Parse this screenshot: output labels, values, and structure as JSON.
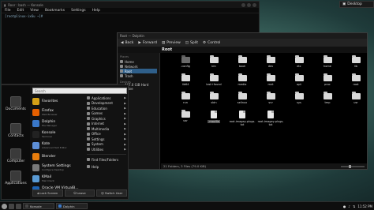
{
  "desktop": {
    "label": "Desktop"
  },
  "terminal": {
    "title": "Roor : bash — Konsole",
    "menu": [
      "File",
      "Edit",
      "View",
      "Bookmarks",
      "Settings",
      "Help"
    ],
    "prompt": "[root@linux-ix6u ~]#"
  },
  "file_manager": {
    "title": "Root — Dolphin",
    "toolbar": [
      "Back",
      "Forward",
      "Preview",
      "Split",
      "Control"
    ],
    "path": "Root",
    "places_heading": "Places",
    "devices_heading": "Devices",
    "places": [
      "Home",
      "Network",
      "Root",
      "Trash"
    ],
    "selected_place": "Root",
    "devices": [
      "447.0 GiB Hard Drive"
    ],
    "items": [
      {
        "name": ".config",
        "kind": "folder-dark"
      },
      {
        "name": "bin",
        "kind": "folder"
      },
      {
        "name": "boot",
        "kind": "folder"
      },
      {
        "name": "dev",
        "kind": "folder"
      },
      {
        "name": "etc",
        "kind": "folder"
      },
      {
        "name": "home",
        "kind": "folder"
      },
      {
        "name": "lib",
        "kind": "folder"
      },
      {
        "name": "lib64",
        "kind": "folder"
      },
      {
        "name": "lost+found",
        "kind": "folder"
      },
      {
        "name": "media",
        "kind": "folder"
      },
      {
        "name": "mnt",
        "kind": "folder"
      },
      {
        "name": "opt",
        "kind": "folder"
      },
      {
        "name": "proc",
        "kind": "folder"
      },
      {
        "name": "root",
        "kind": "folder"
      },
      {
        "name": "run",
        "kind": "folder"
      },
      {
        "name": "sbin",
        "kind": "folder"
      },
      {
        "name": "selinux",
        "kind": "folder"
      },
      {
        "name": "srv",
        "kind": "folder"
      },
      {
        "name": "sys",
        "kind": "folder"
      },
      {
        "name": "tmp",
        "kind": "folder"
      },
      {
        "name": "usr",
        "kind": "folder"
      },
      {
        "name": "var",
        "kind": "folder"
      },
      {
        "name": ".mozilla",
        "kind": "file",
        "highlight": true
      },
      {
        "name": "root.imagey-plugs.\ntxt",
        "kind": "file"
      },
      {
        "name": "root.imagey-plugs.\ntxt",
        "kind": "file"
      }
    ],
    "status": "21 Folders, 3 Files (79.0 KiB)"
  },
  "start_menu": {
    "search_placeholder": "Search",
    "sidebar": [
      "Documents",
      "Contacts",
      "Computer",
      "Applications"
    ],
    "favorites": [
      {
        "name": "Favorites",
        "sub": "",
        "color": "#d4a017"
      },
      {
        "name": "Firefox",
        "sub": "Web Browser",
        "color": "#e66000"
      },
      {
        "name": "Dolphin",
        "sub": "File Manager",
        "color": "#3a78c9"
      },
      {
        "name": "Konsole",
        "sub": "Terminal",
        "color": "#222222"
      },
      {
        "name": "Kate",
        "sub": "Advanced Text Editor",
        "color": "#5d8fd8"
      },
      {
        "name": "Blender",
        "sub": "",
        "color": "#e87d0d"
      },
      {
        "name": "System Settings",
        "sub": "Configure Desktop",
        "color": "#7a7a7a"
      },
      {
        "name": "KMail",
        "sub": "Mail Client",
        "color": "#5a9bd5"
      },
      {
        "name": "Oracle VM VirtualB...",
        "sub": "Virtual Machine",
        "color": "#1e64b4"
      }
    ],
    "categories": [
      "Applications",
      "Development",
      "Education",
      "Games",
      "Graphics",
      "Internet",
      "Multimedia",
      "Office",
      "Settings",
      "System",
      "Utilities"
    ],
    "extra": [
      "Find Files/Folders",
      "Help"
    ],
    "bottom_buttons": [
      "Lock Screen",
      "Leave",
      "Switch User"
    ]
  },
  "taskbar": {
    "tasks": [
      "Konsole",
      "Dolphin"
    ],
    "time": "11:52 PM"
  }
}
